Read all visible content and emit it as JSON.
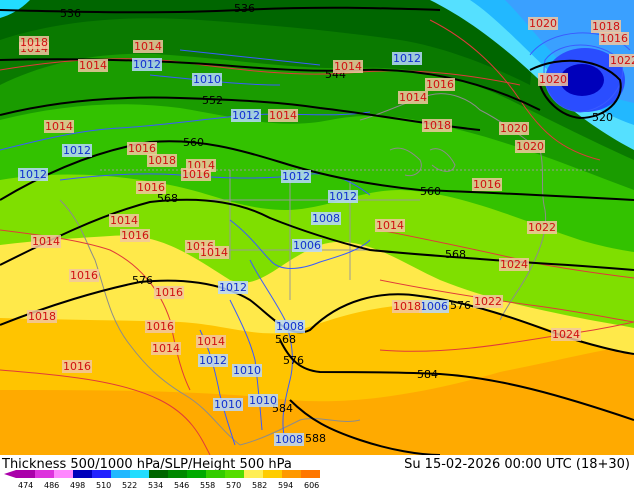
{
  "title": {
    "left": "Thickness 500/1000 hPa/SLP/Height 500 hPa",
    "right": "Su 15-02-2026 00:00 UTC (18+30)"
  },
  "colorbar": {
    "labels": [
      "474",
      "486",
      "498",
      "510",
      "522",
      "534",
      "546",
      "558",
      "570",
      "582",
      "594",
      "606"
    ],
    "colors": [
      "#aa00aa",
      "#dd33dd",
      "#ff88ff",
      "#0000bb",
      "#2222ff",
      "#22b8ff",
      "#22ddff",
      "#006600",
      "#008800",
      "#00aa00",
      "#33cc00",
      "#55dd00",
      "#ffee55",
      "#ffcc00",
      "#ff9900",
      "#ff7700"
    ]
  },
  "contours": {
    "height_labels": [
      "536",
      "536",
      "544",
      "552",
      "560",
      "568",
      "560",
      "568",
      "576",
      "576",
      "584",
      "584",
      "588",
      "568",
      "576",
      "520"
    ],
    "pressure_labels": [
      {
        "v": "1014",
        "c": "r"
      },
      {
        "v": "1012",
        "c": "b"
      },
      {
        "v": "1018",
        "c": "r"
      },
      {
        "v": "1014",
        "c": "r"
      },
      {
        "v": "1010",
        "c": "b"
      },
      {
        "v": "1012",
        "c": "b"
      },
      {
        "v": "1014",
        "c": "r"
      },
      {
        "v": "1014",
        "c": "r"
      },
      {
        "v": "1012",
        "c": "b"
      },
      {
        "v": "1016",
        "c": "r"
      },
      {
        "v": "1014",
        "c": "r"
      },
      {
        "v": "1018",
        "c": "r"
      },
      {
        "v": "1014",
        "c": "r"
      },
      {
        "v": "1012",
        "c": "b"
      },
      {
        "v": "1016",
        "c": "r"
      },
      {
        "v": "1016",
        "c": "r"
      },
      {
        "v": "1016",
        "c": "r"
      },
      {
        "v": "1014",
        "c": "r"
      },
      {
        "v": "1016",
        "c": "r"
      },
      {
        "v": "1014",
        "c": "r"
      },
      {
        "v": "1016",
        "c": "r"
      },
      {
        "v": "1016",
        "c": "r"
      },
      {
        "v": "1014",
        "c": "r"
      },
      {
        "v": "1012",
        "c": "b"
      },
      {
        "v": "1008",
        "c": "b"
      },
      {
        "v": "1010",
        "c": "b"
      },
      {
        "v": "1006",
        "c": "b"
      },
      {
        "v": "1012",
        "c": "b"
      },
      {
        "v": "1012",
        "c": "b"
      },
      {
        "v": "1008",
        "c": "b"
      },
      {
        "v": "1016",
        "c": "r"
      },
      {
        "v": "1018",
        "c": "r"
      },
      {
        "v": "1016",
        "c": "r"
      },
      {
        "v": "1014",
        "c": "r"
      },
      {
        "v": "1012",
        "c": "b"
      },
      {
        "v": "1014",
        "c": "r"
      },
      {
        "v": "1018",
        "c": "r"
      },
      {
        "v": "1010",
        "c": "b"
      },
      {
        "v": "1010",
        "c": "b"
      },
      {
        "v": "1008",
        "c": "b"
      },
      {
        "v": "1006",
        "c": "b"
      },
      {
        "v": "1014",
        "c": "r"
      },
      {
        "v": "1016",
        "c": "r"
      },
      {
        "v": "1014",
        "c": "r"
      },
      {
        "v": "1018",
        "c": "r"
      },
      {
        "v": "1012",
        "c": "b"
      },
      {
        "v": "1016",
        "c": "r"
      },
      {
        "v": "1020",
        "c": "r"
      },
      {
        "v": "1020",
        "c": "r"
      },
      {
        "v": "1020",
        "c": "r"
      },
      {
        "v": "1022",
        "c": "r"
      },
      {
        "v": "1024",
        "c": "r"
      },
      {
        "v": "1022",
        "c": "r"
      },
      {
        "v": "1024",
        "c": "r"
      },
      {
        "v": "1020",
        "c": "r"
      },
      {
        "v": "1018",
        "c": "r"
      },
      {
        "v": "1016",
        "c": "r"
      },
      {
        "v": "1022",
        "c": "r"
      },
      {
        "v": "1014",
        "c": "r"
      }
    ]
  }
}
